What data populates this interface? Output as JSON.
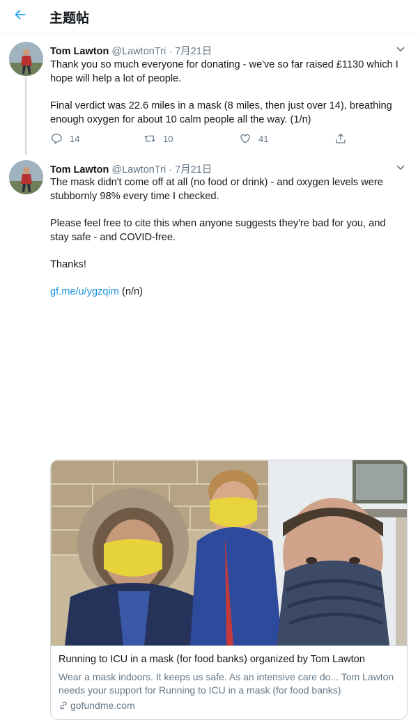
{
  "header": {
    "title": "主题帖",
    "back_icon": "arrow-left-icon"
  },
  "tweets": [
    {
      "name": "Tom Lawton",
      "handle": "@LawtonTri",
      "sep": "·",
      "date": "7月21日",
      "paragraphs": [
        "Thank you so much everyone for donating - we've so far raised £1130 which I hope will help a lot of people.",
        "Final verdict was 22.6 miles in a mask (8 miles, then just over 14), breathing enough oxygen for about 10 calm people all the way. (1/n)"
      ],
      "replies": "14",
      "retweets": "10",
      "likes": "41"
    },
    {
      "name": "Tom Lawton",
      "handle": "@LawtonTri",
      "sep": "·",
      "date": "7月21日",
      "paragraphs": [
        "The mask didn't come off at all (no food or drink) - and oxygen levels were stubbornly 98% every time I checked.",
        "Please feel free to cite this when anyone suggests they're bad for you, and stay safe - and COVID-free.",
        "Thanks!"
      ],
      "link_text": "gf.me/u/ygzqim",
      "link_suffix": " (n/n)"
    }
  ],
  "card": {
    "title": "Running to ICU in a mask (for food banks) organized by Tom Lawton",
    "description": "Wear a mask indoors. It keeps us safe.  As an intensive care do... Tom Lawton needs your support for Running to ICU in a mask (for food banks)",
    "domain": "gofundme.com"
  },
  "colors": {
    "accent": "#1da1f2",
    "link": "#1b95e0",
    "muted": "#657786",
    "border": "#e6ecf0"
  }
}
